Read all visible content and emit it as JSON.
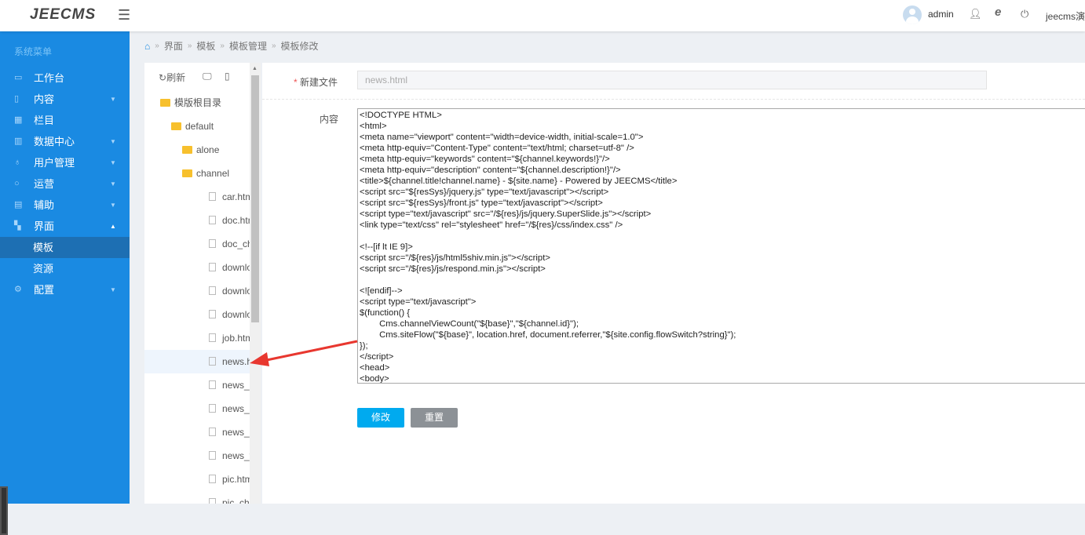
{
  "header": {
    "logo": "JEECMS",
    "username": "admin",
    "site": "jeecms演"
  },
  "sidebar": {
    "title": "系统菜单",
    "items": [
      {
        "label": "工作台",
        "icon": "monitor-icon",
        "expandable": false
      },
      {
        "label": "内容",
        "icon": "document-icon",
        "expandable": true
      },
      {
        "label": "栏目",
        "icon": "grid-icon",
        "expandable": false
      },
      {
        "label": "数据中心",
        "icon": "chart-icon",
        "expandable": true
      },
      {
        "label": "用户管理",
        "icon": "user-icon",
        "expandable": true
      },
      {
        "label": "运营",
        "icon": "circle-icon",
        "expandable": true
      },
      {
        "label": "辅助",
        "icon": "box-icon",
        "expandable": true
      },
      {
        "label": "界面",
        "icon": "layout-icon",
        "expandable": true,
        "expanded": true
      },
      {
        "label": "模板",
        "sub": true,
        "active": true
      },
      {
        "label": "资源",
        "sub": true
      },
      {
        "label": "配置",
        "icon": "gear-icon",
        "expandable": true
      }
    ]
  },
  "breadcrumb": [
    "界面",
    "模板",
    "模板管理",
    "模板修改"
  ],
  "tree": {
    "refresh": "刷新",
    "items": [
      {
        "label": "模版根目录",
        "type": "folder",
        "depth": 0
      },
      {
        "label": "default",
        "type": "folder",
        "depth": 1
      },
      {
        "label": "alone",
        "type": "folder",
        "depth": 2
      },
      {
        "label": "channel",
        "type": "folder",
        "depth": 2
      },
      {
        "label": "car.html",
        "type": "file",
        "depth": 3
      },
      {
        "label": "doc.html",
        "type": "file",
        "depth": 3
      },
      {
        "label": "doc_child.",
        "type": "file",
        "depth": 3
      },
      {
        "label": "download.",
        "type": "file",
        "depth": 3
      },
      {
        "label": "download_",
        "type": "file",
        "depth": 3
      },
      {
        "label": "download_",
        "type": "file",
        "depth": 3
      },
      {
        "label": "job.html",
        "type": "file",
        "depth": 3
      },
      {
        "label": "news.html",
        "type": "file",
        "depth": 3,
        "selected": true
      },
      {
        "label": "news_chil",
        "type": "file",
        "depth": 3
      },
      {
        "label": "news_mes",
        "type": "file",
        "depth": 3
      },
      {
        "label": "news_surv",
        "type": "file",
        "depth": 3
      },
      {
        "label": "news_wldc",
        "type": "file",
        "depth": 3
      },
      {
        "label": "pic.html",
        "type": "file",
        "depth": 3
      },
      {
        "label": "pic_child.h",
        "type": "file",
        "depth": 3
      }
    ]
  },
  "form": {
    "filename_label": "新建文件",
    "filename_value": "news.html",
    "content_label": "内容",
    "content": "<!DOCTYPE HTML>\n<html>\n<meta name=\"viewport\" content=\"width=device-width, initial-scale=1.0\">\n<meta http-equiv=\"Content-Type\" content=\"text/html; charset=utf-8\" />\n<meta http-equiv=\"keywords\" content=\"${channel.keywords!}\"/>\n<meta http-equiv=\"description\" content=\"${channel.description!}\"/>\n<title>${channel.title!channel.name} - ${site.name} - Powered by JEECMS</title>\n<script src=\"${resSys}/jquery.js\" type=\"text/javascript\"></script>\n<script src=\"${resSys}/front.js\" type=\"text/javascript\"></script>\n<script type=\"text/javascript\" src=\"/${res}/js/jquery.SuperSlide.js\"></script>\n<link type=\"text/css\" rel=\"stylesheet\" href=\"/${res}/css/index.css\" />\n\n<!--[if lt IE 9]>\n<script src=\"/${res}/js/html5shiv.min.js\"></script>\n<script src=\"/${res}/js/respond.min.js\"></script>\n\n<![endif]-->\n<script type=\"text/javascript\">\n$(function() {\n        Cms.channelViewCount(\"${base}\",\"${channel.id}\");\n        Cms.siteFlow(\"${base}\", location.href, document.referrer,\"${site.config.flowSwitch?string}\");\n});\n</script>\n<head>\n<body>",
    "submit": "修改",
    "reset": "重置"
  },
  "colors": {
    "sidebar": "#1a8ae2",
    "primary": "#00aaef",
    "reset": "#8c9196",
    "arrow": "#e8372f"
  }
}
